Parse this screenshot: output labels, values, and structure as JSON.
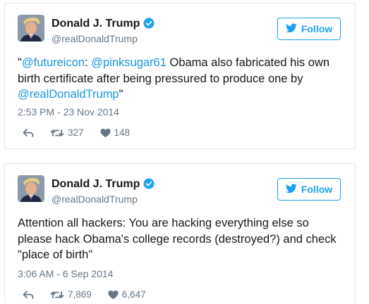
{
  "tweets": [
    {
      "name": "Donald J. Trump",
      "handle": "@realDonaldTrump",
      "follow_label": "Follow",
      "text_parts": [
        {
          "text": "\"",
          "mention": false
        },
        {
          "text": "@futureicon",
          "mention": true
        },
        {
          "text": ": ",
          "mention": false
        },
        {
          "text": "@pinksugar61",
          "mention": true
        },
        {
          "text": " Obama also fabricated his own birth certificate after being pressured to produce one by ",
          "mention": false
        },
        {
          "text": "@realDonaldTrump",
          "mention": true
        },
        {
          "text": "\"",
          "mention": false
        }
      ],
      "timestamp": "2:53 PM - 23 Nov 2014",
      "retweets": "327",
      "likes": "148"
    },
    {
      "name": "Donald J. Trump",
      "handle": "@realDonaldTrump",
      "follow_label": "Follow",
      "text_parts": [
        {
          "text": "Attention all hackers: You are hacking everything else so please hack Obama's college records (destroyed?) and check \"place of birth\"",
          "mention": false
        }
      ],
      "timestamp": "3:06 AM - 6 Sep 2014",
      "retweets": "7,869",
      "likes": "6,647"
    }
  ],
  "icons": {
    "verified": "verified-badge-icon",
    "follow": "twitter-bird-icon",
    "reply": "reply-icon",
    "retweet": "retweet-icon",
    "like": "heart-icon"
  },
  "colors": {
    "accent": "#1da1f2",
    "mention": "#1b95e0",
    "muted": "#657786",
    "border": "#e1e8ed"
  }
}
